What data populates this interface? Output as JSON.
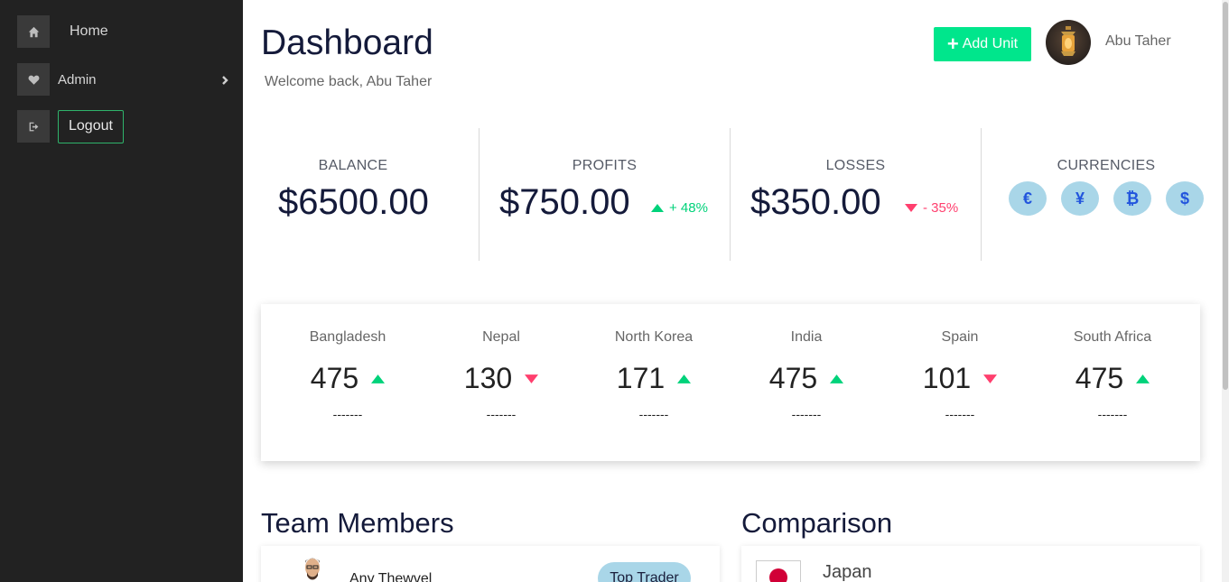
{
  "sidebar": {
    "items": [
      {
        "label": "Home",
        "icon": "home-icon"
      },
      {
        "label": "Admin",
        "icon": "heart-icon"
      },
      {
        "label": "Logout",
        "icon": "sign-out-icon"
      }
    ]
  },
  "header": {
    "title": "Dashboard",
    "subtitle": "Welcome back, Abu Taher",
    "add_button": "Add Unit",
    "user_name": "Abu Taher"
  },
  "stats": {
    "balance": {
      "label": "BALANCE",
      "value": "$6500.00"
    },
    "profits": {
      "label": "PROFITS",
      "value": "$750.00",
      "trend": "+ 48%",
      "direction": "up"
    },
    "losses": {
      "label": "LOSSES",
      "value": "$350.00",
      "trend": "- 35%",
      "direction": "down"
    },
    "currencies": {
      "label": "CURRENCIES",
      "symbols": [
        "€",
        "¥",
        "₿",
        "$"
      ]
    }
  },
  "countries": [
    {
      "name": "Bangladesh",
      "value": "475",
      "direction": "up",
      "detail": "-------"
    },
    {
      "name": "Nepal",
      "value": "130",
      "direction": "down",
      "detail": "-------"
    },
    {
      "name": "North Korea",
      "value": "171",
      "direction": "up",
      "detail": "-------"
    },
    {
      "name": "India",
      "value": "475",
      "direction": "up",
      "detail": "-------"
    },
    {
      "name": "Spain",
      "value": "101",
      "direction": "down",
      "detail": "-------"
    },
    {
      "name": "South Africa",
      "value": "475",
      "direction": "up",
      "detail": "-------"
    }
  ],
  "team": {
    "title": "Team Members",
    "members": [
      {
        "name": "Any Thewvel",
        "badge": "Top Trader"
      }
    ]
  },
  "comparison": {
    "title": "Comparison",
    "items": [
      {
        "country": "Japan"
      }
    ]
  },
  "colors": {
    "up": "#00d27a",
    "down": "#ff3f6e",
    "accent": "#00e68c",
    "sidebar": "#222222"
  }
}
